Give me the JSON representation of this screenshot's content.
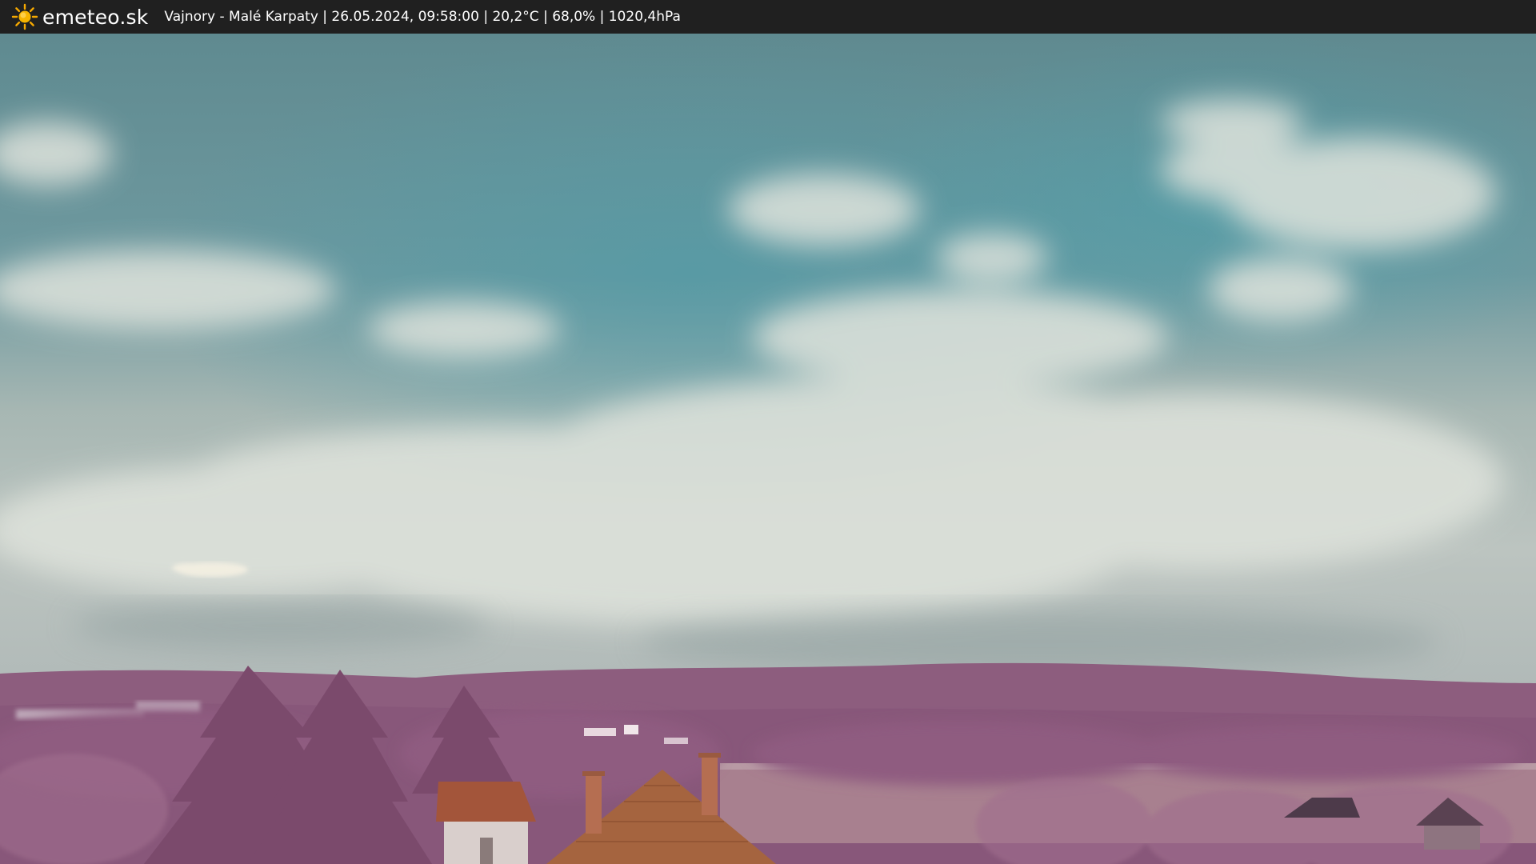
{
  "header": {
    "logo_icon": "sun-icon",
    "brand": "emeteo.sk",
    "caption": "Vajnory - Malé Karpaty | 26.05.2024, 09:58:00 | 20,2°C | 68,0% | 1020,4hPa"
  },
  "webcam": {
    "image_subject": "Infrared webcam view of cloudy sky over purple-tinted hills, trees and rooftops"
  },
  "colors": {
    "bar_background": "#202020",
    "text": "#ffffff",
    "sun": "#f5a800",
    "sky_top": "#5e8e95",
    "clouds": "#d2d8d2",
    "hills": "#8c5a7a",
    "trees": "#9a6282",
    "roof": "#a35a3c"
  }
}
